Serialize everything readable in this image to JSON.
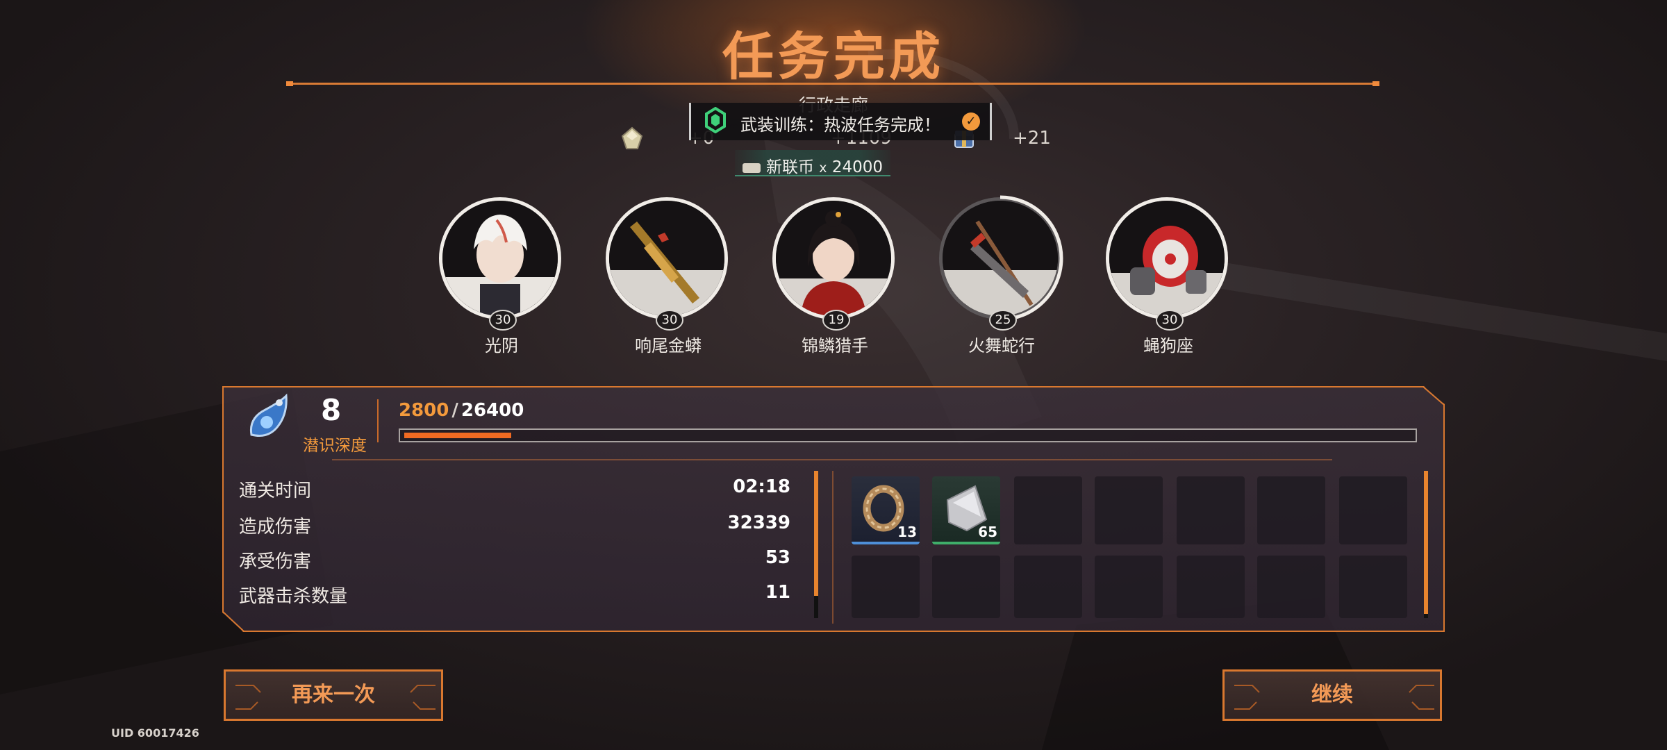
{
  "title": "任务完成",
  "location": "行政走廊",
  "toast": {
    "text": "武装训练：热波任务完成！"
  },
  "rewards": {
    "left_value": "+0",
    "mid_value": "+1109",
    "right_value": "+21",
    "coin_label": "新联币",
    "coin_times": "x",
    "coin_amount": "24000"
  },
  "party": [
    {
      "name": "光阴",
      "level": "30"
    },
    {
      "name": "响尾金蟒",
      "level": "30"
    },
    {
      "name": "锦鳞猎手",
      "level": "19"
    },
    {
      "name": "火舞蛇行",
      "level": "25"
    },
    {
      "name": "蝇狗座",
      "level": "30"
    }
  ],
  "depth": {
    "level": "8",
    "label": "潜识深度",
    "exp_current": "2800",
    "exp_separator": "/",
    "exp_max": "26400",
    "exp_fraction": 0.106
  },
  "stats": [
    {
      "label": "通关时间",
      "value": "02:18"
    },
    {
      "label": "造成伤害",
      "value": "32339"
    },
    {
      "label": "承受伤害",
      "value": "53"
    },
    {
      "label": "武器击杀数量",
      "value": "11"
    }
  ],
  "loot": [
    {
      "item": "ring-item-icon",
      "count": "13",
      "rarity_color": "#4e8fd8"
    },
    {
      "item": "metal-plate-icon",
      "count": "65",
      "rarity_color": "#3fae6a"
    }
  ],
  "buttons": {
    "again": "再来一次",
    "continue": "继续"
  },
  "uid": "UID 60017426",
  "colors": {
    "accent": "#f39a3c",
    "frame": "#d9782f",
    "exp_fill": "#f06a22"
  }
}
